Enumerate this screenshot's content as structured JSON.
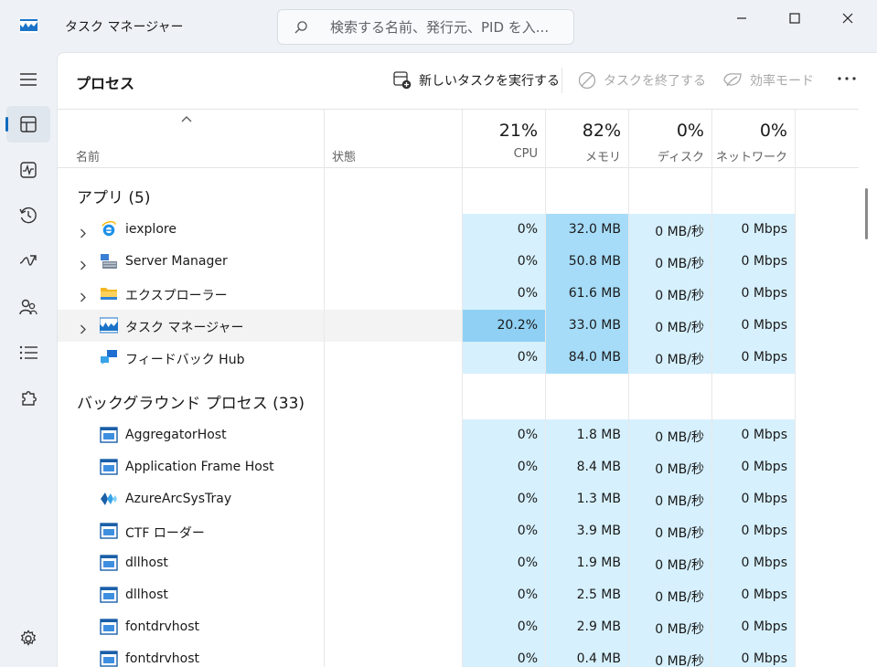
{
  "app": {
    "title": "タスク マネージャー",
    "search_placeholder": "検索する名前、発行元、PID を入..."
  },
  "toolbar": {
    "page_title": "プロセス",
    "run_task": "新しいタスクを実行する",
    "end_task": "タスクを終了する",
    "efficiency": "効率モード"
  },
  "columns": {
    "name": "名前",
    "status": "状態",
    "cpu_pct": "21%",
    "cpu": "CPU",
    "mem_pct": "82%",
    "mem": "メモリ",
    "disk_pct": "0%",
    "disk": "ディスク",
    "net_pct": "0%",
    "net": "ネットワーク"
  },
  "sections": {
    "apps": "アプリ (5)",
    "background": "バックグラウンド プロセス (33)"
  },
  "apps": [
    {
      "name": "iexplore",
      "icon": "ie-icon",
      "cpu": "0%",
      "mem": "32.0 MB",
      "disk": "0 MB/秒",
      "net": "0 Mbps"
    },
    {
      "name": "Server Manager",
      "icon": "server-manager-icon",
      "cpu": "0%",
      "mem": "50.8 MB",
      "disk": "0 MB/秒",
      "net": "0 Mbps"
    },
    {
      "name": "エクスプローラー",
      "icon": "folder-icon",
      "cpu": "0%",
      "mem": "61.6 MB",
      "disk": "0 MB/秒",
      "net": "0 Mbps"
    },
    {
      "name": "タスク マネージャー",
      "icon": "task-manager-icon",
      "cpu": "20.2%",
      "mem": "33.0 MB",
      "disk": "0 MB/秒",
      "net": "0 Mbps"
    },
    {
      "name": "フィードバック Hub",
      "icon": "feedback-hub-icon",
      "cpu": "0%",
      "mem": "84.0 MB",
      "disk": "0 MB/秒",
      "net": "0 Mbps"
    }
  ],
  "background": [
    {
      "name": "AggregatorHost",
      "icon": "window-app-icon",
      "cpu": "0%",
      "mem": "1.8 MB",
      "disk": "0 MB/秒",
      "net": "0 Mbps"
    },
    {
      "name": "Application Frame Host",
      "icon": "window-app-icon",
      "cpu": "0%",
      "mem": "8.4 MB",
      "disk": "0 MB/秒",
      "net": "0 Mbps"
    },
    {
      "name": "AzureArcSysTray",
      "icon": "azure-arc-icon",
      "cpu": "0%",
      "mem": "1.3 MB",
      "disk": "0 MB/秒",
      "net": "0 Mbps"
    },
    {
      "name": "CTF ローダー",
      "icon": "window-app-icon",
      "cpu": "0%",
      "mem": "3.9 MB",
      "disk": "0 MB/秒",
      "net": "0 Mbps"
    },
    {
      "name": "dllhost",
      "icon": "window-app-icon",
      "cpu": "0%",
      "mem": "1.9 MB",
      "disk": "0 MB/秒",
      "net": "0 Mbps"
    },
    {
      "name": "dllhost",
      "icon": "window-app-icon",
      "cpu": "0%",
      "mem": "2.5 MB",
      "disk": "0 MB/秒",
      "net": "0 Mbps"
    },
    {
      "name": "fontdrvhost",
      "icon": "window-app-icon",
      "cpu": "0%",
      "mem": "2.9 MB",
      "disk": "0 MB/秒",
      "net": "0 Mbps"
    },
    {
      "name": "fontdrvhost",
      "icon": "window-app-icon",
      "cpu": "0%",
      "mem": "0.4 MB",
      "disk": "0 MB/秒",
      "net": "0 Mbps"
    }
  ],
  "colors": {
    "heat_low": "#d6f0fd",
    "heat_med": "#a6dcf8",
    "heat_high": "#8fd0f4",
    "accent": "#0f6cbd"
  }
}
